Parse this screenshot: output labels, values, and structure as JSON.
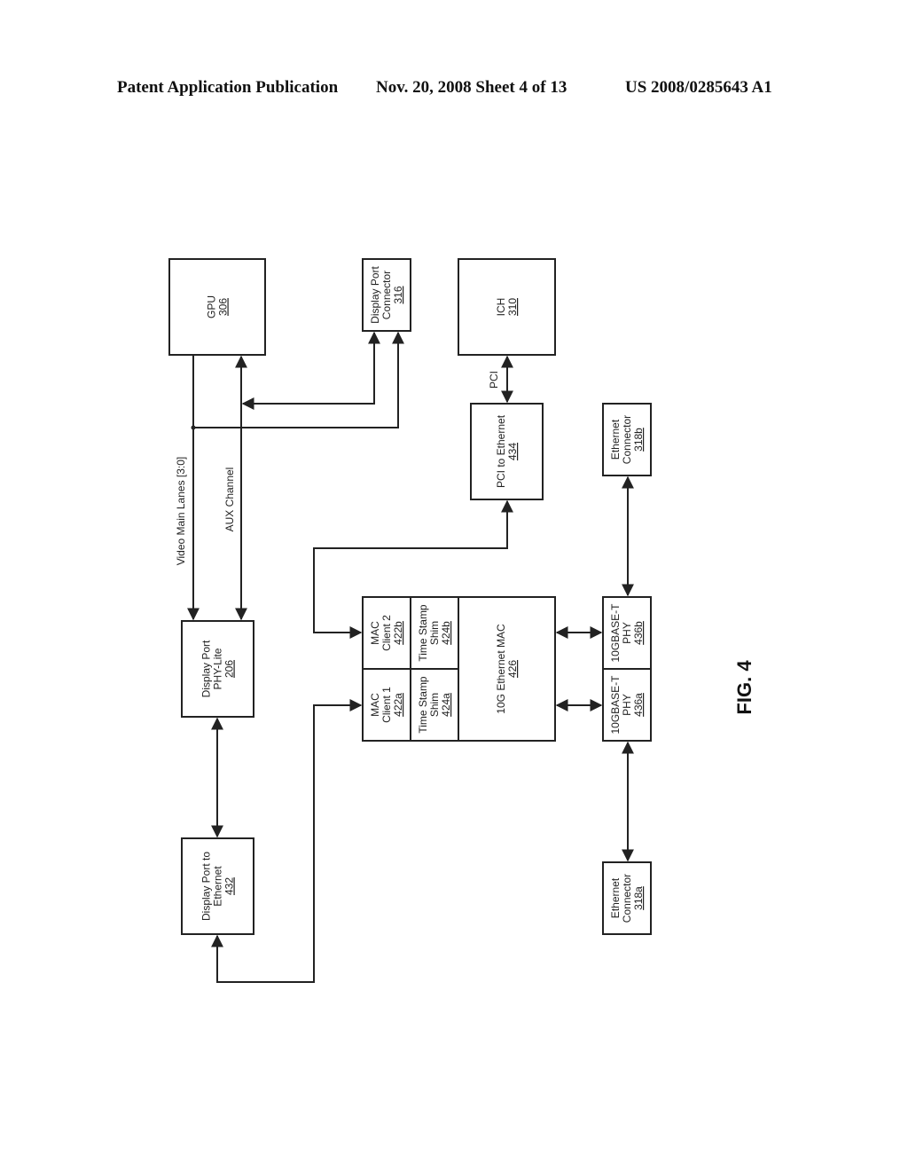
{
  "header": {
    "left": "Patent Application Publication",
    "middle": "Nov. 20, 2008   Sheet 4 of 13",
    "right": "US 2008/0285643 A1"
  },
  "figure_label": "FIG. 4",
  "blocks": {
    "gpu": {
      "lines": [
        "GPU"
      ],
      "ref": "306"
    },
    "dp_connector": {
      "lines": [
        "Display Port",
        "Connector"
      ],
      "ref": "316"
    },
    "ich": {
      "lines": [
        "ICH"
      ],
      "ref": "310"
    },
    "pci_to_eth": {
      "lines": [
        "PCI to Ethernet"
      ],
      "ref": "434"
    },
    "eth_conn_b": {
      "lines": [
        "Ethernet",
        "Connector"
      ],
      "ref": "318b"
    },
    "dp_phy_lite": {
      "lines": [
        "Display Port",
        "PHY-Lite"
      ],
      "ref": "206"
    },
    "mac_client_2": {
      "lines": [
        "MAC",
        "Client 2"
      ],
      "ref": "422b"
    },
    "ts_shim_b": {
      "lines": [
        "Time Stamp",
        "Shim"
      ],
      "ref": "424b"
    },
    "mac_client_1": {
      "lines": [
        "MAC",
        "Client 1"
      ],
      "ref": "422a"
    },
    "ts_shim_a": {
      "lines": [
        "Time Stamp",
        "Shim"
      ],
      "ref": "424a"
    },
    "eth_mac": {
      "lines": [
        "10G Ethernet MAC"
      ],
      "ref": "426"
    },
    "phy_b": {
      "lines": [
        "10GBASE-T",
        "PHY"
      ],
      "ref": "436b"
    },
    "phy_a": {
      "lines": [
        "10GBASE-T",
        "PHY"
      ],
      "ref": "436a"
    },
    "dp_to_eth": {
      "lines": [
        "Display Port to",
        "Ethernet"
      ],
      "ref": "432"
    },
    "eth_conn_a": {
      "lines": [
        "Ethernet",
        "Connector"
      ],
      "ref": "318a"
    }
  },
  "signal_labels": {
    "video_main_lanes": "Video Main Lanes [3:0]",
    "aux_channel": "AUX Channel",
    "pci": "PCI"
  }
}
